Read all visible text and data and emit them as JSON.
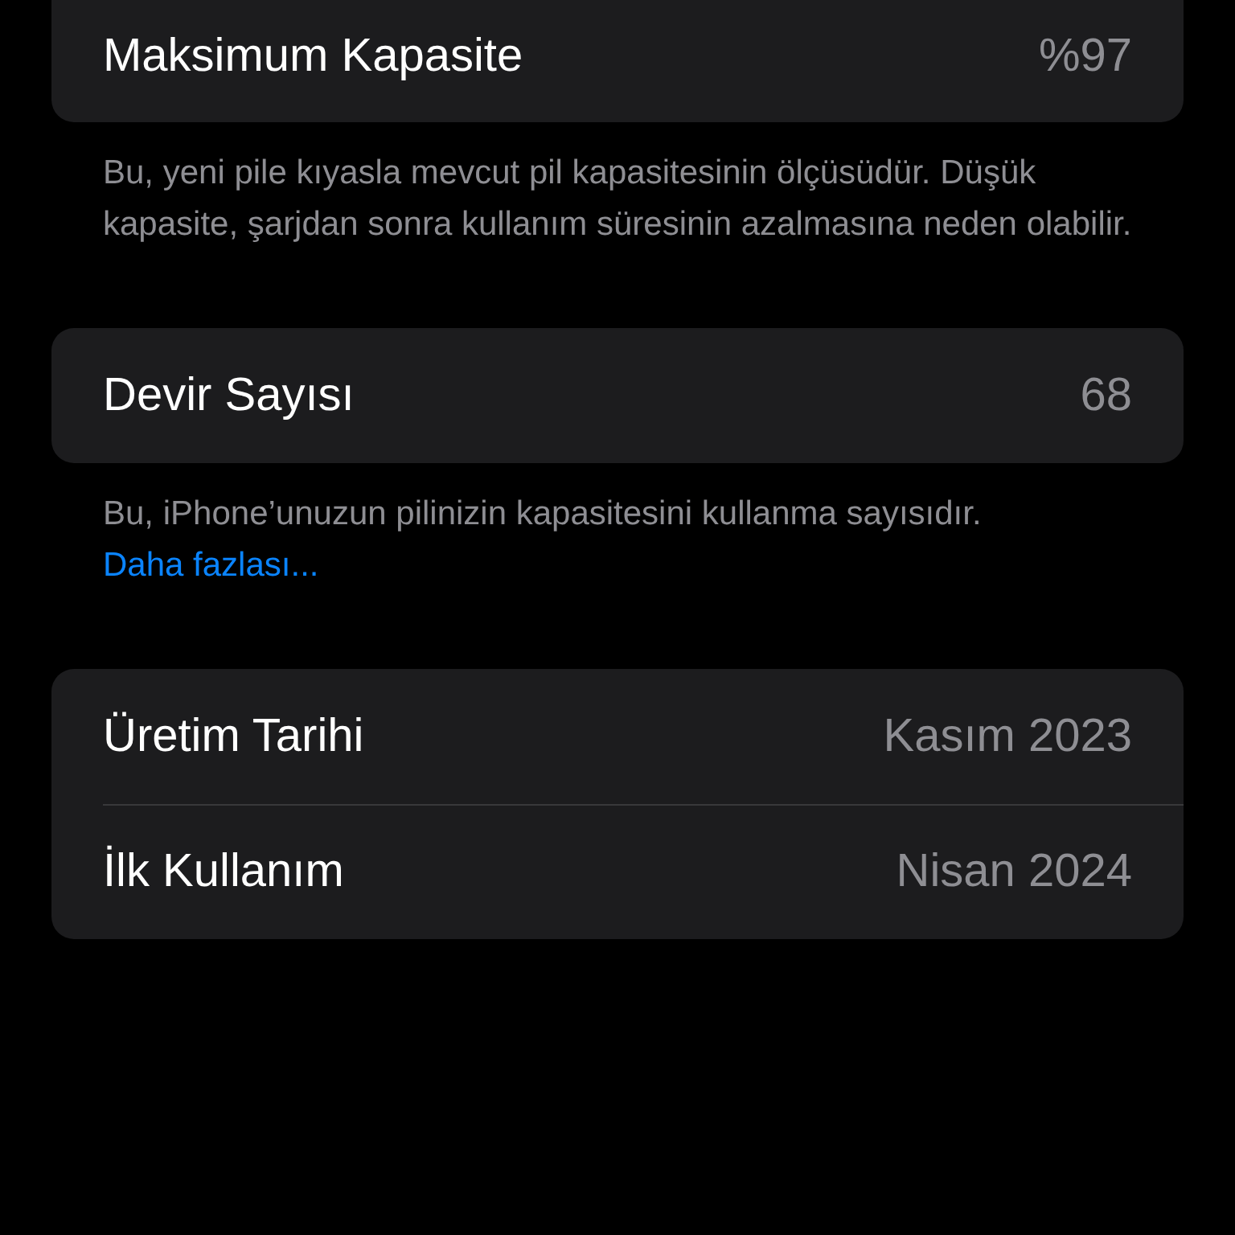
{
  "sections": [
    {
      "rows": [
        {
          "label": "Maksimum Kapasite",
          "value": "%97"
        }
      ],
      "footer": "Bu, yeni pile kıyasla mevcut pil kapasitesinin ölçüsüdür. Düşük kapasite, şarjdan sonra kullanım süresinin azalmasına neden olabilir."
    },
    {
      "rows": [
        {
          "label": "Devir Sayısı",
          "value": "68"
        }
      ],
      "footer": "Bu, iPhone’unuzun pilinizin kapasitesini kullanma sayısıdır.",
      "footer_link": "Daha fazlası..."
    },
    {
      "rows": [
        {
          "label": "Üretim Tarihi",
          "value": "Kasım 2023"
        },
        {
          "label": "İlk Kullanım",
          "value": "Nisan 2024"
        }
      ]
    }
  ]
}
